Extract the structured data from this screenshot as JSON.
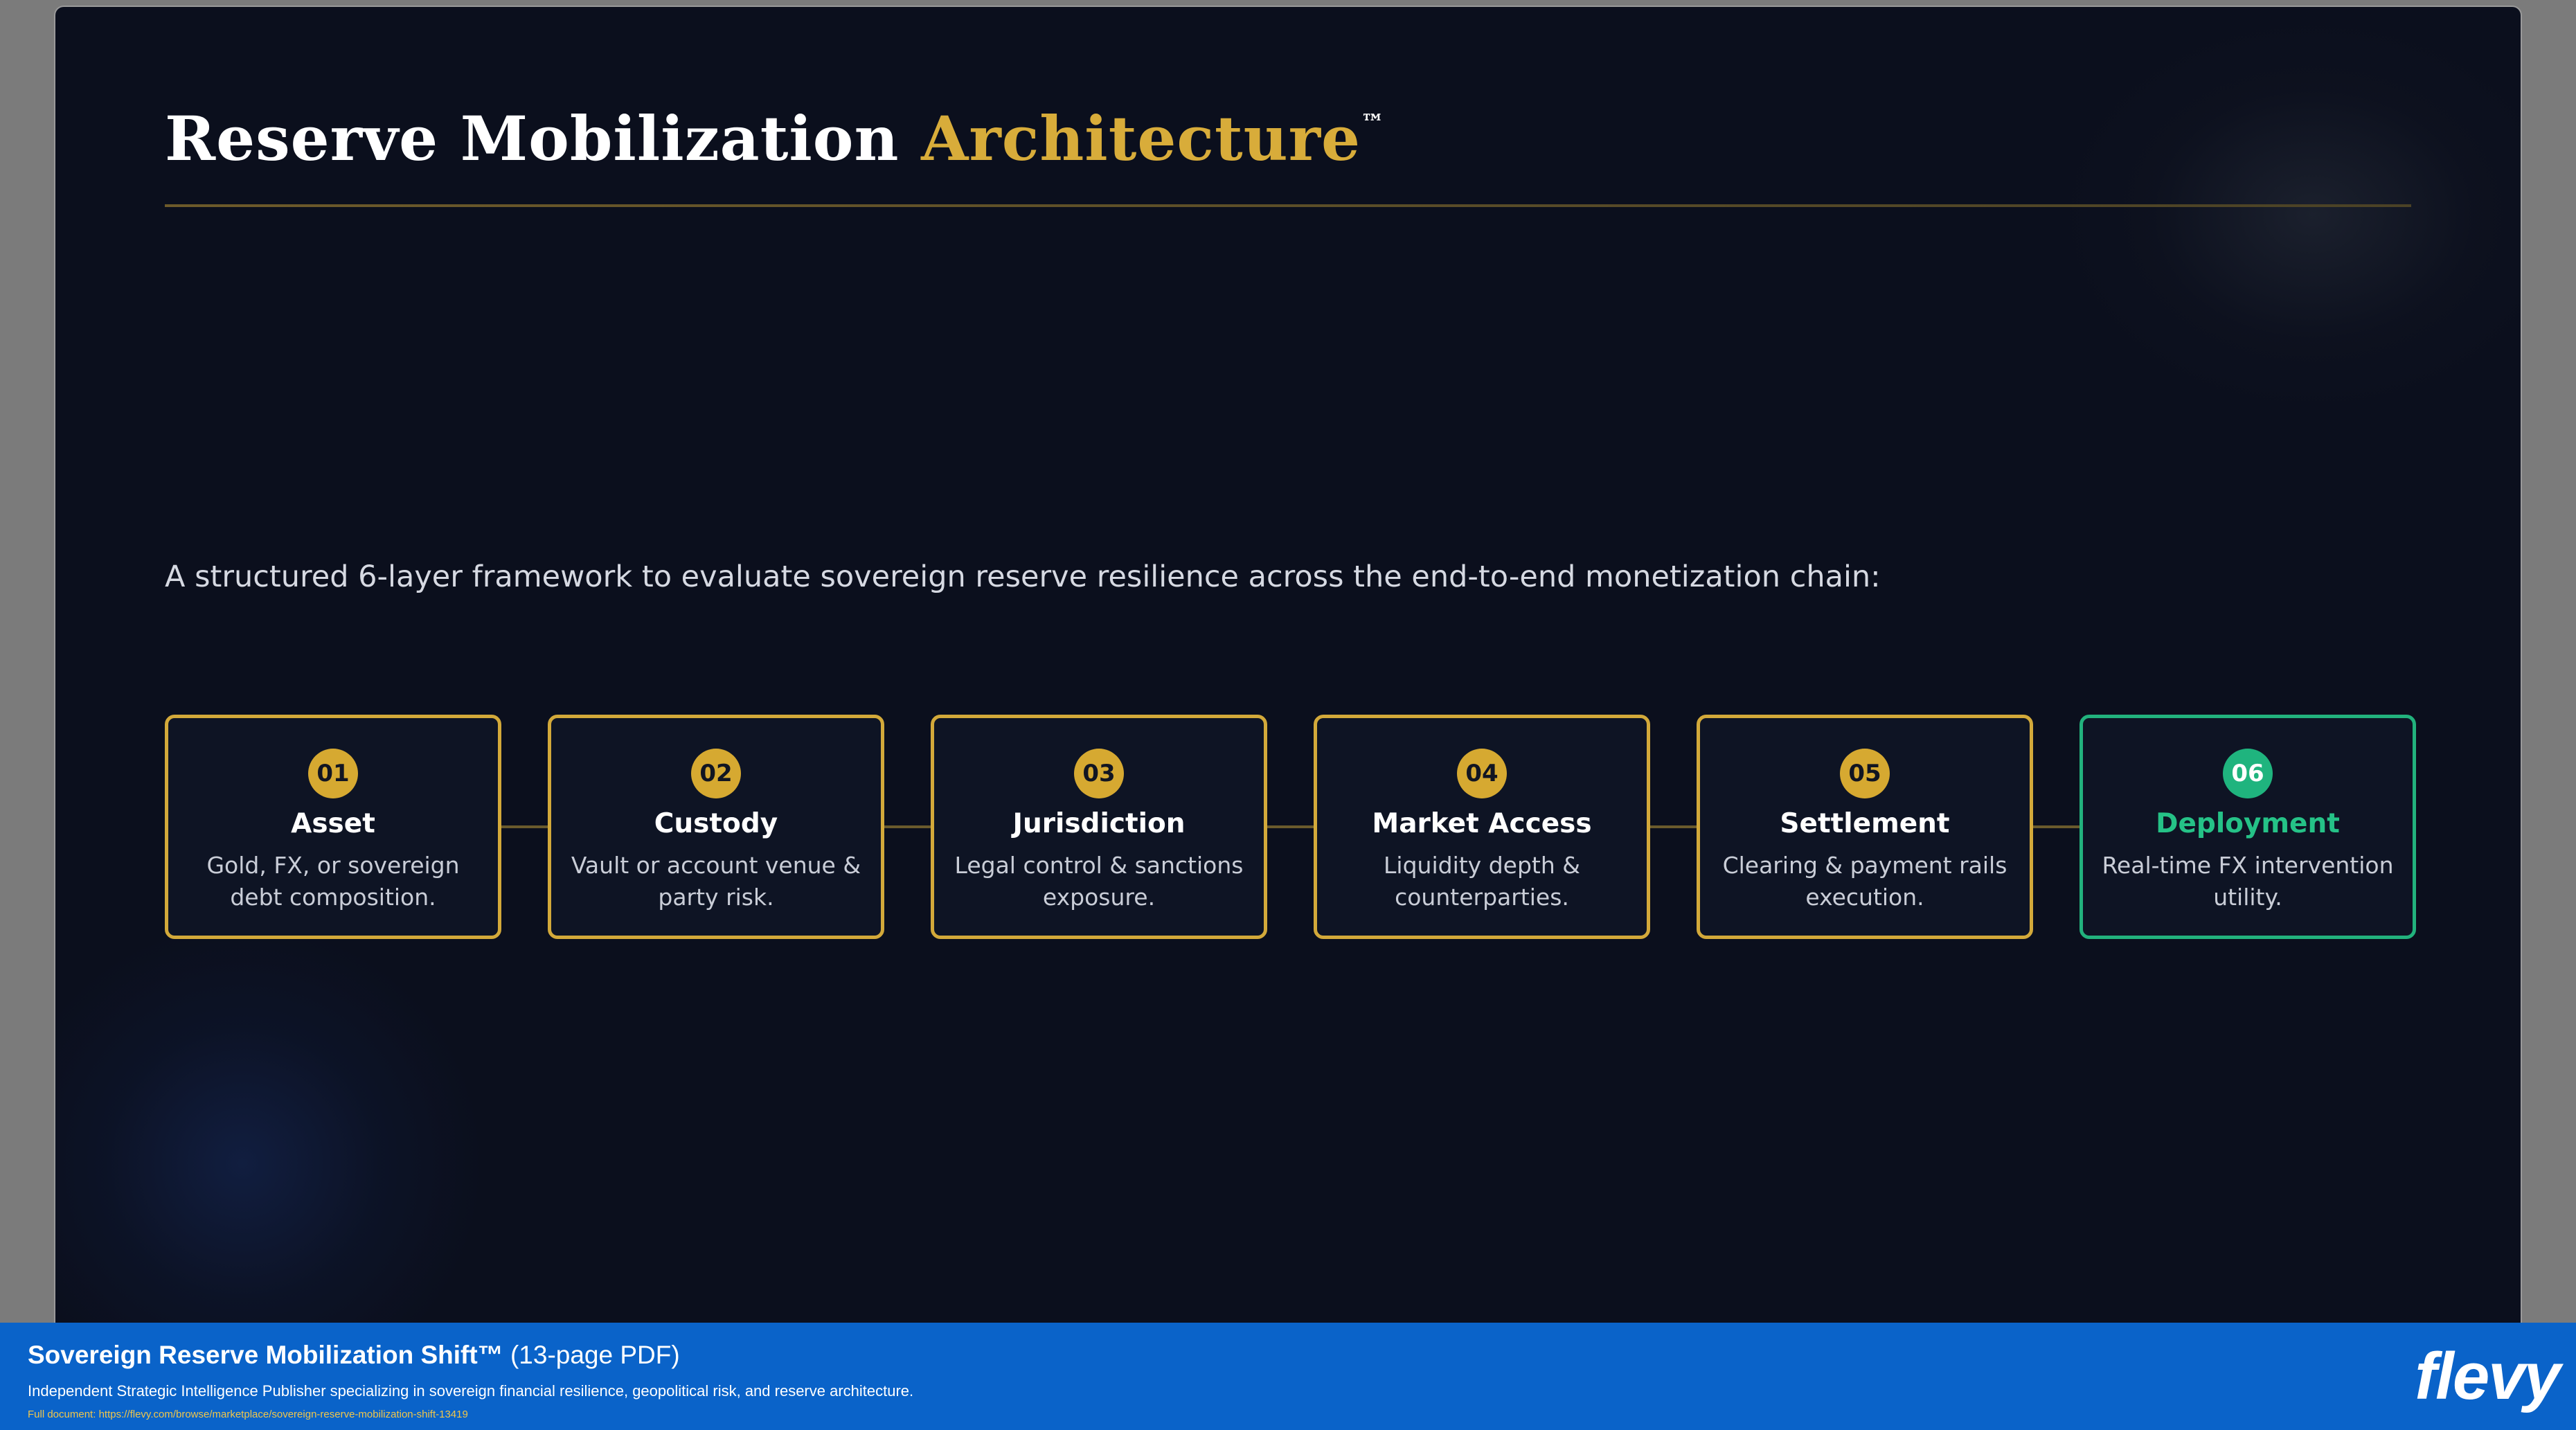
{
  "slide": {
    "title": {
      "part1": "Reserve Mobilization",
      "part2": "Architecture",
      "trademark": "™"
    },
    "intro": "A structured 6-layer framework to evaluate sovereign reserve resilience across the end-to-end monetization chain:",
    "steps": [
      {
        "number": "01",
        "title": "Asset",
        "desc_line1": "Gold, FX, or sovereign",
        "desc_line2": "debt composition."
      },
      {
        "number": "02",
        "title": "Custody",
        "desc_line1": "Vault or account venue &",
        "desc_line2": "party risk."
      },
      {
        "number": "03",
        "title": "Jurisdiction",
        "desc_line1": "Legal control & sanctions",
        "desc_line2": "exposure."
      },
      {
        "number": "04",
        "title": "Market Access",
        "desc_line1": "Liquidity depth &",
        "desc_line2": "counterparties."
      },
      {
        "number": "05",
        "title": "Settlement",
        "desc_line1": "Clearing & payment rails",
        "desc_line2": "execution."
      },
      {
        "number": "06",
        "title": "Deployment",
        "desc_line1": "Real-time FX intervention",
        "desc_line2": "utility."
      }
    ],
    "colors": {
      "background": "#0b0f1d",
      "gold": "#d3a93a",
      "green": "#22b27d"
    }
  },
  "footer": {
    "doc_title": "Sovereign Reserve Mobilization Shift™",
    "pages": "(13-page PDF)",
    "subtitle": "Independent Strategic Intelligence Publisher specializing in sovereign financial resilience, geopolitical risk, and reserve architecture.",
    "link_label": "Full document:",
    "link_url": "https://flevy.com/browse/marketplace/sovereign-reserve-mobilization-shift-13419",
    "logo": "flevy",
    "color": "#0a63c9"
  }
}
